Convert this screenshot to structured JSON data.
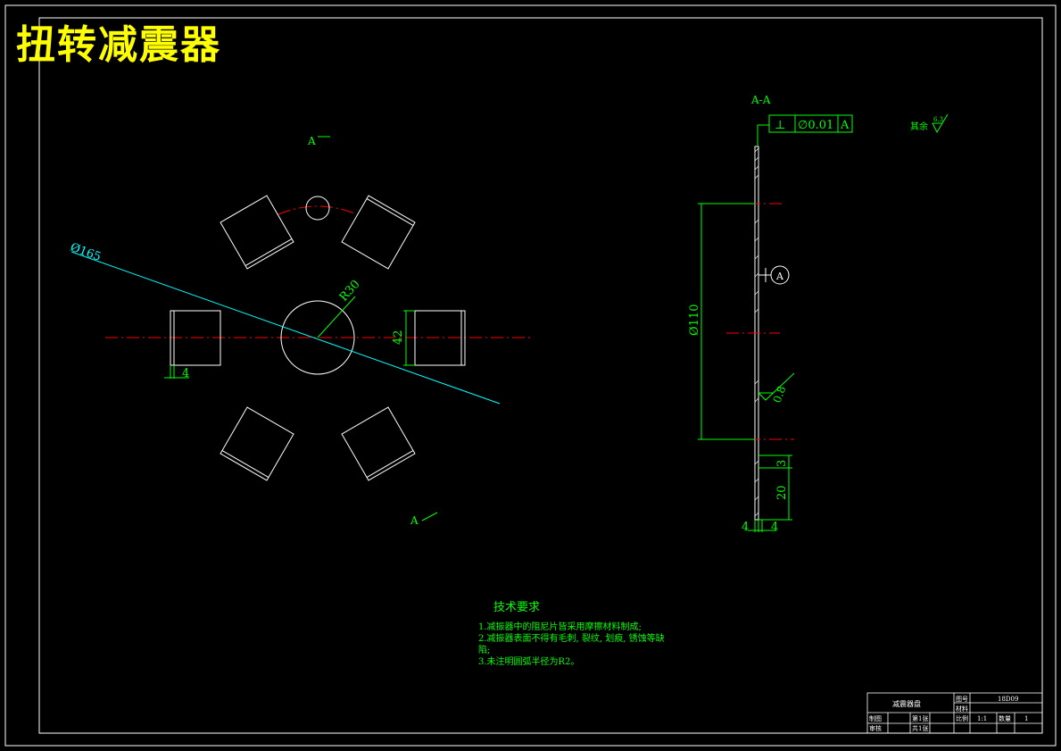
{
  "page": {
    "title": "扭转减震器"
  },
  "colors": {
    "background": "#000000",
    "outline": "#ffffff",
    "annotation": "#00ff00",
    "dimension_cyan": "#00ffff",
    "centerline": "#ff0000",
    "title": "#ffff00"
  },
  "front_view": {
    "section_mark_top": "A",
    "section_mark_bottom": "A",
    "diameter_165": "Ø165",
    "radius_30": "R30",
    "dim_42": "42",
    "dim_4": "4"
  },
  "section_view": {
    "title": "A-A",
    "tolerance_symbol": "⊥",
    "tolerance_value": "∅0.01",
    "tolerance_datum": "A",
    "datum_marker": "A",
    "diameter_110": "Ø110",
    "roughness_value": "0.8",
    "dim_3": "3",
    "dim_20": "20",
    "dim_4_left": "4",
    "dim_4_right": "4",
    "surface_note_label": "其余",
    "surface_note_value": "6.3"
  },
  "tech_requirements": {
    "heading": "技术要求",
    "line1": "1.减振器中的阻尼片皆采用摩擦材料制成;",
    "line2": "2.减振器表面不得有毛刺, 裂纹, 划痕, 锈蚀等缺",
    "line2b": "陷;",
    "line3": "3.未注明圆弧半径为R2。"
  },
  "title_block": {
    "part_name": "减震器盘",
    "drawing_no_label": "图号",
    "drawing_no": "18D09",
    "material_label": "材料",
    "drawn_label": "制图",
    "reviewed_label": "审核",
    "sheet_label": "第1张",
    "total_label": "共1张",
    "scale_label": "比例",
    "scale_value": "1:1",
    "qty_label": "数量",
    "qty_value": "1"
  }
}
